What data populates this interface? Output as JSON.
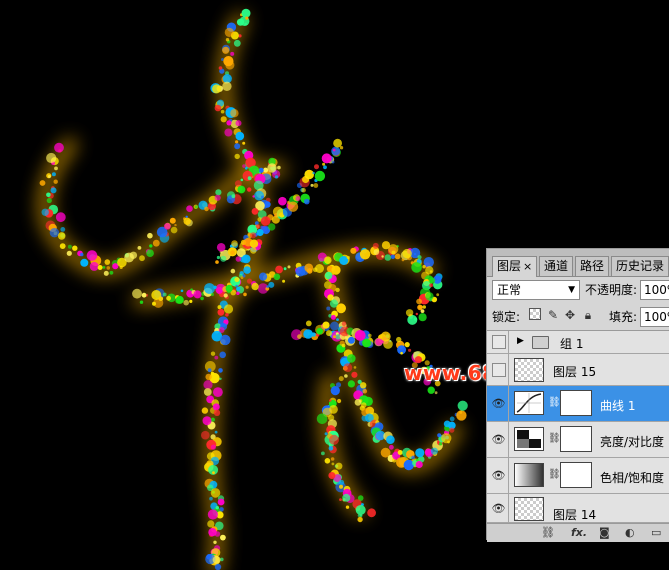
{
  "watermark": "www.68ps.com",
  "panel": {
    "tabs": [
      {
        "label": "图层",
        "close": "×"
      },
      {
        "label": "通道"
      },
      {
        "label": "路径"
      },
      {
        "label": "历史记录"
      }
    ],
    "blend_mode": "正常",
    "opacity_label": "不透明度:",
    "opacity_value": "100%",
    "lock_label": "锁定:",
    "fill_label": "填充:",
    "fill_value": "100%",
    "layers": [
      {
        "name": "组 1",
        "type": "group"
      },
      {
        "name": "图层 15",
        "type": "pixel"
      },
      {
        "name": "曲线 1",
        "type": "adjustment-curves",
        "selected": true
      },
      {
        "name": "亮度/对比度",
        "type": "adjustment-brightness"
      },
      {
        "name": "色相/饱和度",
        "type": "adjustment-hue"
      },
      {
        "name": "图层 14",
        "type": "pixel"
      }
    ],
    "bottom_icons": [
      "link-icon",
      "fx-icon",
      "mask-icon",
      "adjustment-icon",
      "folder-icon"
    ],
    "bottom_labels": {
      "fx": "fx."
    }
  },
  "colors": {
    "selected": "#3b91e6",
    "watermark": "#ff3a1a",
    "glow": "#f0b000"
  }
}
